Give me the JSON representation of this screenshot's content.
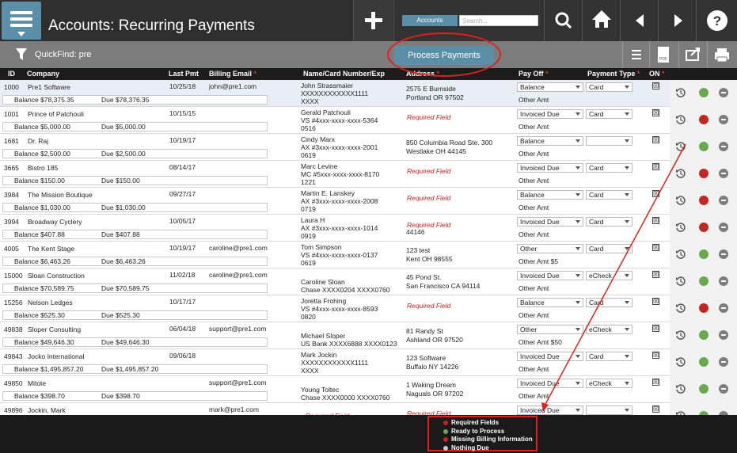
{
  "app": {
    "title": "Accounts: Recurring Payments"
  },
  "toolbar": {
    "accounts_label": "Accounts",
    "search_placeholder": "Search..."
  },
  "subbar": {
    "quickfind_label": "QuickFind: pre",
    "process_label": "Process Payments"
  },
  "columns": {
    "id": "ID",
    "company": "Company",
    "last_pmt": "Last Pmt",
    "billing_email": "Billing Email",
    "name_card": "Name/Card Number/Exp",
    "address": "Address",
    "pay_off": "Pay Off",
    "payment_type": "Payment Type",
    "on": "ON"
  },
  "rows": [
    {
      "id": "1000",
      "company": "Pre1 Software",
      "last": "10/25/18",
      "email": "john@pre1.com",
      "name1": "John Strassmaier",
      "name2": "XXXXXXXXXXXX1111",
      "name3": "XXXX",
      "addr1": "2575 E Burnside",
      "addr2": "Portland OR 97502",
      "addr_req": "",
      "name_req": "",
      "payoff": "Balance",
      "ptype": "Card",
      "other": "Other Amt",
      "bal": "Balance  $78,375.35",
      "due": "Due $78,376.35",
      "status": "green",
      "checked": "☒"
    },
    {
      "id": "1001",
      "company": "Prince of Patchouli",
      "last": "10/15/15",
      "email": "",
      "name1": "Gerald Patchouli",
      "name2": "VS #4xxx-xxxx-xxxx-5364",
      "name3": "0516",
      "addr1": "",
      "addr2": "",
      "addr_req": "Required Field",
      "name_req": "",
      "payoff": "Invoiced Due",
      "ptype": "Card",
      "other": "Other Amt",
      "bal": "Balance  $5,000.00",
      "due": "Due $5,000.00",
      "status": "red",
      "checked": "☒"
    },
    {
      "id": "1681",
      "company": "Dr. Raj",
      "last": "10/19/17",
      "email": "",
      "name1": "Cindy Marx",
      "name2": "AX #3xxx-xxxx-xxxx-2001",
      "name3": "0619",
      "addr1": "850 Columbia Road Ste. 300",
      "addr2": "Westlake OH 44145",
      "addr_req": "",
      "name_req": "",
      "payoff": "Balance",
      "ptype": "",
      "other": "Other Amt",
      "bal": "Balance  $2,500.00",
      "due": "Due $2,500.00",
      "status": "green",
      "checked": "☒"
    },
    {
      "id": "3665",
      "company": "Bistro 185",
      "last": "08/14/17",
      "email": "",
      "name1": "Marc Levine",
      "name2": "MC #5xxx-xxxx-xxxx-8170",
      "name3": "1221",
      "addr1": "",
      "addr2": "",
      "addr_req": "Required Field",
      "name_req": "",
      "payoff": "Invoiced Due",
      "ptype": "Card",
      "other": "Other Amt",
      "bal": "Balance  $150.00",
      "due": "Due $150.00",
      "status": "red",
      "checked": "☒"
    },
    {
      "id": "3984",
      "company": "The Mission Boutique",
      "last": "09/27/17",
      "email": "",
      "name1": "Martin E. Lanskey",
      "name2": "AX #3xxx-xxxx-xxxx-2008",
      "name3": "0719",
      "addr1": "",
      "addr2": "",
      "addr_req": "Required Field",
      "name_req": "",
      "payoff": "Balance",
      "ptype": "Card",
      "other": "Other Amt",
      "bal": "Balance  $1,030.00",
      "due": "Due $1,030.00",
      "status": "red",
      "checked": "☒"
    },
    {
      "id": "3994",
      "company": "Broadway Cyclery",
      "last": "10/05/17",
      "email": "",
      "name1": "Laura H",
      "name2": "AX #3xxx-xxxx-xxxx-1014",
      "name3": "0919",
      "addr1": "",
      "addr2": "44146",
      "addr_req": "Required Field",
      "name_req": "",
      "payoff": "Invoiced Due",
      "ptype": "Card",
      "other": "Other Amt",
      "bal": "Balance  $407.88",
      "due": "Due $407.88",
      "status": "red",
      "checked": "☒"
    },
    {
      "id": "4005",
      "company": "The Kent Stage",
      "last": "10/19/17",
      "email": "caroline@pre1.com",
      "name1": "Tom Simpson",
      "name2": "VS #4xxx-xxxx-xxxx-0137",
      "name3": "0619",
      "addr1": "123 test",
      "addr2": "Kent OH 98555",
      "addr_req": "",
      "name_req": "",
      "payoff": "Other",
      "ptype": "Card",
      "other": "Other Amt  $5",
      "bal": "Balance  $6,463.26",
      "due": "Due $6,463.26",
      "status": "green",
      "checked": "☒"
    },
    {
      "id": "15000",
      "company": "Sloan Construction",
      "last": "11/02/18",
      "email": "caroline@pre1.com",
      "name1": "",
      "name2": "Caroline Sloan",
      "name3": "Chase XXXX0204 XXXX0760",
      "addr1": "45 Pond St.",
      "addr2": "San Francisco CA 94114",
      "addr_req": "",
      "name_req": "",
      "payoff": "Invoiced Due",
      "ptype": "eCheck",
      "other": "Other Amt",
      "bal": "Balance  $70,589.75",
      "due": "Due $70,589.75",
      "status": "green",
      "checked": "☒"
    },
    {
      "id": "15256",
      "company": "Nelson Ledges",
      "last": "10/17/17",
      "email": "",
      "name1": "Joretta Frohing",
      "name2": "VS #4xxx-xxxx-xxxx-8593",
      "name3": "0820",
      "addr1": "",
      "addr2": "",
      "addr_req": "Required Field",
      "name_req": "",
      "payoff": "Balance",
      "ptype": "Card",
      "other": "Other Amt",
      "bal": "Balance  $525.30",
      "due": "Due $525.30",
      "status": "red",
      "checked": "☒"
    },
    {
      "id": "49838",
      "company": "Sloper Consulting",
      "last": "06/04/18",
      "email": "support@pre1.com",
      "name1": "",
      "name2": "Michael Sloper",
      "name3": "US Bank XXXX6888 XXXX0123",
      "addr1": "81 Randy St",
      "addr2": "Ashland OR 97520",
      "addr_req": "",
      "name_req": "",
      "payoff": "Other",
      "ptype": "eCheck",
      "other": "Other Amt  $50",
      "bal": "Balance  $49,646.30",
      "due": "Due $49,646.30",
      "status": "green",
      "checked": "☒"
    },
    {
      "id": "49843",
      "company": "Jocko International",
      "last": "09/06/18",
      "email": "",
      "name1": "Mark Jockin",
      "name2": "XXXXXXXXXXXX1111",
      "name3": "XXXX",
      "addr1": "123 Software",
      "addr2": "Buffalo NY 14226",
      "addr_req": "",
      "name_req": "",
      "payoff": "Invoiced Due",
      "ptype": "Card",
      "other": "Other Amt",
      "bal": "Balance  $1,495,857.20",
      "due": "Due $1,495,857.20",
      "status": "green",
      "checked": "☒"
    },
    {
      "id": "49850",
      "company": "Mitote",
      "last": "",
      "email": "support@pre1.com",
      "name1": "",
      "name2": "Young Toltec",
      "name3": "Chase XXXX0000 XXXX0760",
      "addr1": "1 Waking Dream",
      "addr2": "Naguals OR 97202",
      "addr_req": "",
      "name_req": "",
      "payoff": "Invoiced Due",
      "ptype": "eCheck",
      "other": "Other Amt",
      "bal": "Balance  $398.70",
      "due": "Due $398.70",
      "status": "green",
      "checked": "☒"
    },
    {
      "id": "49896",
      "company": "Jockin, Mark",
      "last": "",
      "email": "mark@pre1.com",
      "name1": "",
      "name2": "",
      "name3": "",
      "addr1": "",
      "addr2": "",
      "addr_req": "Required Field",
      "name_req": "Required Field",
      "payoff": "Invoiced Due",
      "ptype": "",
      "other": "",
      "bal": "",
      "due": "",
      "status": "green",
      "checked": "☒"
    }
  ],
  "legend": [
    {
      "label": "Required Fields",
      "color": "#d21e1e"
    },
    {
      "label": "Ready to Process",
      "color": "#6aa84f"
    },
    {
      "label": "Missing Billing Information",
      "color": "#d21e1e"
    },
    {
      "label": "Nothing Due",
      "color": "#cccccc"
    }
  ],
  "colors": {
    "green": "#6aa84f",
    "red": "#c0271f",
    "gray": "#cccccc",
    "accent": "#5b8fa8",
    "annotation": "#e02020"
  }
}
